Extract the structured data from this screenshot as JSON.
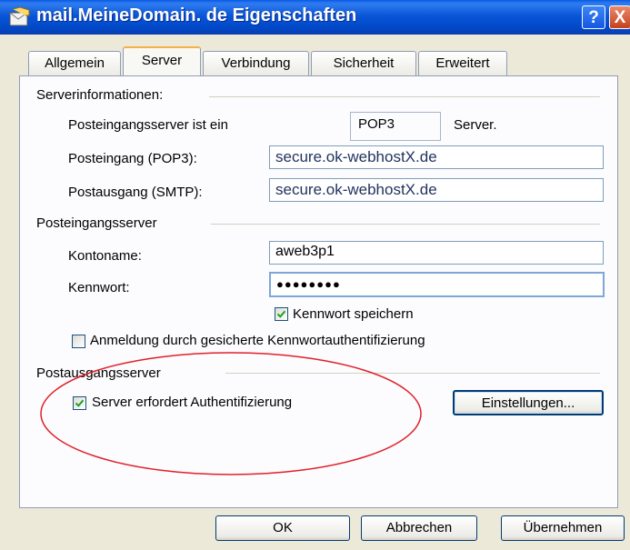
{
  "window": {
    "title": "mail.MeineDomain. de Eigenschaften",
    "help_label": "?",
    "close_label": "X"
  },
  "tabs": [
    {
      "label": "Allgemein"
    },
    {
      "label": "Server"
    },
    {
      "label": "Verbindung"
    },
    {
      "label": "Sicherheit"
    },
    {
      "label": "Erweitert"
    }
  ],
  "active_tab": "Server",
  "serverinfo": {
    "group_label": "Serverinformationen:",
    "type_label": "Posteingangsserver ist ein",
    "type_value": "POP3",
    "type_suffix": "Server.",
    "incoming_label": "Posteingang (POP3):",
    "incoming_value": "secure.ok-webhostX.de",
    "outgoing_label": "Postausgang (SMTP):",
    "outgoing_value": "secure.ok-webhostX.de"
  },
  "incoming_server": {
    "group_label": "Posteingangsserver",
    "account_label": "Kontoname:",
    "account_value": "aweb3p1",
    "password_label": "Kennwort:",
    "password_value": "●●●●●●●●",
    "save_password_label": "Kennwort speichern",
    "save_password_checked": true,
    "spa_label": "Anmeldung durch gesicherte Kennwortauthentifizierung",
    "spa_checked": false
  },
  "outgoing_server": {
    "group_label": "Postausgangsserver",
    "auth_label": "Server erfordert Authentifizierung",
    "auth_checked": true,
    "settings_button": "Einstellungen..."
  },
  "footer": {
    "ok": "OK",
    "cancel": "Abbrechen",
    "apply": "Übernehmen"
  },
  "colors": {
    "titlebar": "#0a56d8",
    "annotation": "#e0202a",
    "checkmark": "#21a121"
  }
}
